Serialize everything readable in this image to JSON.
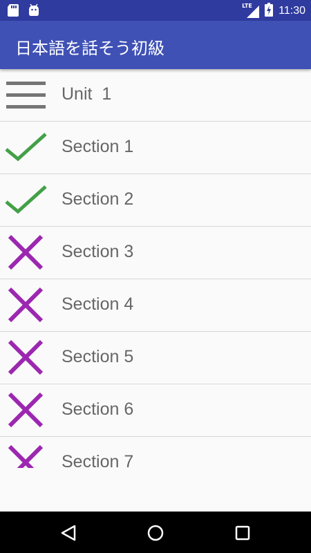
{
  "status_bar": {
    "time": "11:30",
    "network": "LTE",
    "icons": [
      "sd-card-icon",
      "android-icon",
      "signal-icon",
      "battery-charging-icon"
    ]
  },
  "app_bar": {
    "title": "日本語を話そう初級"
  },
  "list": {
    "header": {
      "label": "Unit  1",
      "icon": "menu-icon"
    },
    "items": [
      {
        "label": "Section 1",
        "status": "complete",
        "icon": "check-icon"
      },
      {
        "label": "Section 2",
        "status": "complete",
        "icon": "check-icon"
      },
      {
        "label": "Section 3",
        "status": "incomplete",
        "icon": "cross-icon"
      },
      {
        "label": "Section 4",
        "status": "incomplete",
        "icon": "cross-icon"
      },
      {
        "label": "Section 5",
        "status": "incomplete",
        "icon": "cross-icon"
      },
      {
        "label": "Section 6",
        "status": "incomplete",
        "icon": "cross-icon"
      },
      {
        "label": "Section 7",
        "status": "incomplete",
        "icon": "cross-icon"
      }
    ]
  },
  "nav_bar": {
    "buttons": [
      "back-icon",
      "home-icon",
      "recents-icon"
    ]
  },
  "colors": {
    "status_bar": "#2f3b9e",
    "app_bar": "#3f51b5",
    "check": "#43a047",
    "cross": "#9c27b0",
    "menu": "#757575",
    "label": "#666666"
  }
}
